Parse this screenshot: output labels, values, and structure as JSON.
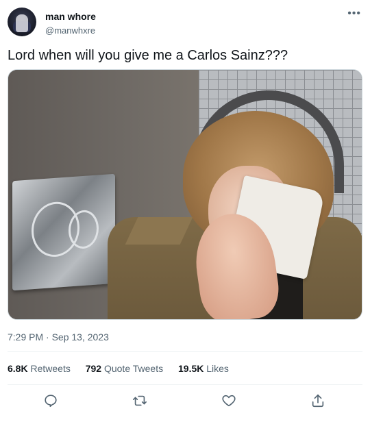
{
  "user": {
    "display_name": "man whore",
    "handle": "@manwhxre",
    "avatar": "profile-photo"
  },
  "tweet": {
    "text": "Lord when will you give me a Carlos Sainz???",
    "time": "7:29 PM",
    "separator": "·",
    "date": "Sep 13, 2023",
    "media": "video-still-crying-with-tissue"
  },
  "stats": {
    "retweets_count": "6.8K",
    "retweets_label": "Retweets",
    "quotes_count": "792",
    "quotes_label": "Quote Tweets",
    "likes_count": "19.5K",
    "likes_label": "Likes"
  },
  "icons": {
    "more": "more-horizontal-icon",
    "reply": "reply-icon",
    "retweet": "retweet-icon",
    "like": "heart-icon",
    "share": "share-icon"
  },
  "colors": {
    "text": "#0f1419",
    "secondary": "#536471",
    "divider": "#eff3f4"
  }
}
